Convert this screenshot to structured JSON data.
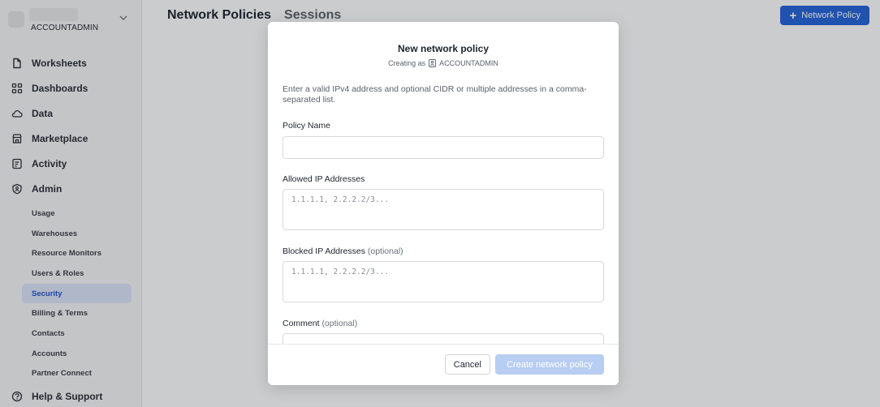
{
  "account": {
    "role": "ACCOUNTADMIN"
  },
  "nav": [
    {
      "label": "Worksheets",
      "icon": "document-icon"
    },
    {
      "label": "Dashboards",
      "icon": "grid-icon"
    },
    {
      "label": "Data",
      "icon": "cloud-icon"
    },
    {
      "label": "Marketplace",
      "icon": "store-icon"
    },
    {
      "label": "Activity",
      "icon": "activity-icon"
    },
    {
      "label": "Admin",
      "icon": "shield-icon"
    }
  ],
  "admin_sub": [
    {
      "label": "Usage"
    },
    {
      "label": "Warehouses"
    },
    {
      "label": "Resource Monitors"
    },
    {
      "label": "Users & Roles"
    },
    {
      "label": "Security",
      "active": true
    },
    {
      "label": "Billing & Terms"
    },
    {
      "label": "Contacts"
    },
    {
      "label": "Accounts"
    },
    {
      "label": "Partner Connect"
    }
  ],
  "help": {
    "label": "Help & Support",
    "icon": "help-icon"
  },
  "main": {
    "tabs": [
      "Network Policies",
      "Sessions"
    ],
    "primary_button": "Network Policy"
  },
  "modal": {
    "title": "New network policy",
    "creating_as_prefix": "Creating as",
    "creating_as_role": "ACCOUNTADMIN",
    "description": "Enter a valid IPv4 address and optional CIDR or multiple addresses in a comma-separated list.",
    "fields": {
      "policy_name": {
        "label": "Policy Name",
        "value": ""
      },
      "allowed_ips": {
        "label": "Allowed IP Addresses",
        "placeholder": "1.1.1.1, 2.2.2.2/3..."
      },
      "blocked_ips": {
        "label": "Blocked IP Addresses",
        "optional": "(optional)",
        "placeholder": "1.1.1.1, 2.2.2.2/3..."
      },
      "comment": {
        "label": "Comment",
        "optional": "(optional)"
      }
    },
    "cancel_label": "Cancel",
    "create_label": "Create network policy"
  },
  "colors": {
    "accent": "#2463d9",
    "active_bg": "#dbe5f8",
    "disabled_btn": "#b8cdf2"
  }
}
